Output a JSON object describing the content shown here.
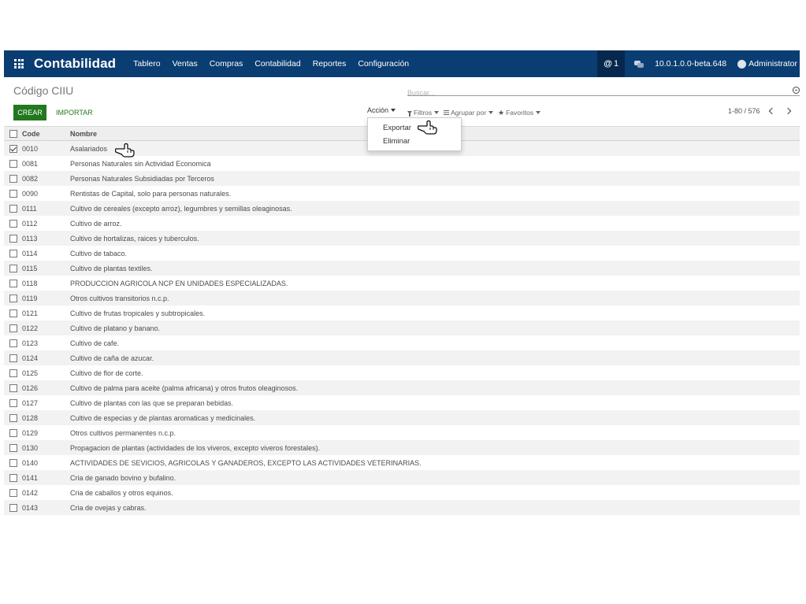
{
  "app": {
    "brand": "Contabilidad",
    "menu": [
      "Tablero",
      "Ventas",
      "Compras",
      "Contabilidad",
      "Reportes",
      "Configuración"
    ],
    "mentions": "1",
    "mention_symbol": "@",
    "version": "10.0.1.0.0-beta.648",
    "user": "Administrator"
  },
  "control": {
    "title": "Código CIIU",
    "search_placeholder": "Buscar...",
    "create_label": "CREAR",
    "import_label": "IMPORTAR",
    "action_label": "Acción",
    "filters_label": "Filtros",
    "groupby_label": "Agrupar por",
    "favorites_label": "Favoritos",
    "pager": "1-80 / 576"
  },
  "dropdown": {
    "items": [
      "Exportar",
      "Eliminar"
    ]
  },
  "table": {
    "columns": [
      "Code",
      "Nombre"
    ],
    "rows": [
      {
        "code": "0010",
        "name": "Asalariados",
        "checked": true
      },
      {
        "code": "0081",
        "name": "Personas Naturales sin Actividad Economica"
      },
      {
        "code": "0082",
        "name": "Personas Naturales Subsidiadas por Terceros"
      },
      {
        "code": "0090",
        "name": "Rentistas de Capital, solo para personas naturales."
      },
      {
        "code": "0111",
        "name": "Cultivo de cereales (excepto arroz), legumbres y semillas oleaginosas."
      },
      {
        "code": "0112",
        "name": "Cultivo de arroz."
      },
      {
        "code": "0113",
        "name": "Cultivo de hortalizas, raices y tuberculos."
      },
      {
        "code": "0114",
        "name": "Cultivo de tabaco."
      },
      {
        "code": "0115",
        "name": "Cultivo de plantas textiles."
      },
      {
        "code": "0118",
        "name": "PRODUCCION AGRICOLA NCP EN UNIDADES ESPECIALIZADAS."
      },
      {
        "code": "0119",
        "name": "Otros cultivos transitorios n.c.p."
      },
      {
        "code": "0121",
        "name": "Cultivo de frutas tropicales y subtropicales."
      },
      {
        "code": "0122",
        "name": "Cultivo de platano y banano."
      },
      {
        "code": "0123",
        "name": "Cultivo de cafe."
      },
      {
        "code": "0124",
        "name": "Cultivo de caña de azucar."
      },
      {
        "code": "0125",
        "name": "Cultivo de flor de corte."
      },
      {
        "code": "0126",
        "name": "Cultivo de palma para aceite (palma africana) y otros frutos oleaginosos."
      },
      {
        "code": "0127",
        "name": "Cultivo de plantas con las que se preparan bebidas."
      },
      {
        "code": "0128",
        "name": "Cultivo de especias y de plantas aromaticas y medicinales."
      },
      {
        "code": "0129",
        "name": "Otros cultivos permanentes n.c.p."
      },
      {
        "code": "0130",
        "name": "Propagacion de plantas (actividades de los viveros, excepto viveros forestales)."
      },
      {
        "code": "0140",
        "name": "ACTIVIDADES DE SEVICIOS, AGRICOLAS Y GANADEROS, EXCEPTO LAS ACTIVIDADES VETERINARIAS."
      },
      {
        "code": "0141",
        "name": "Cria de ganado bovino y bufalino."
      },
      {
        "code": "0142",
        "name": "Cria de caballos y otros equinos."
      },
      {
        "code": "0143",
        "name": "Cria de ovejas y cabras."
      }
    ]
  },
  "colors": {
    "navbar": "#0a3d72",
    "create_button": "#21781e",
    "import_link": "#217a1a"
  }
}
